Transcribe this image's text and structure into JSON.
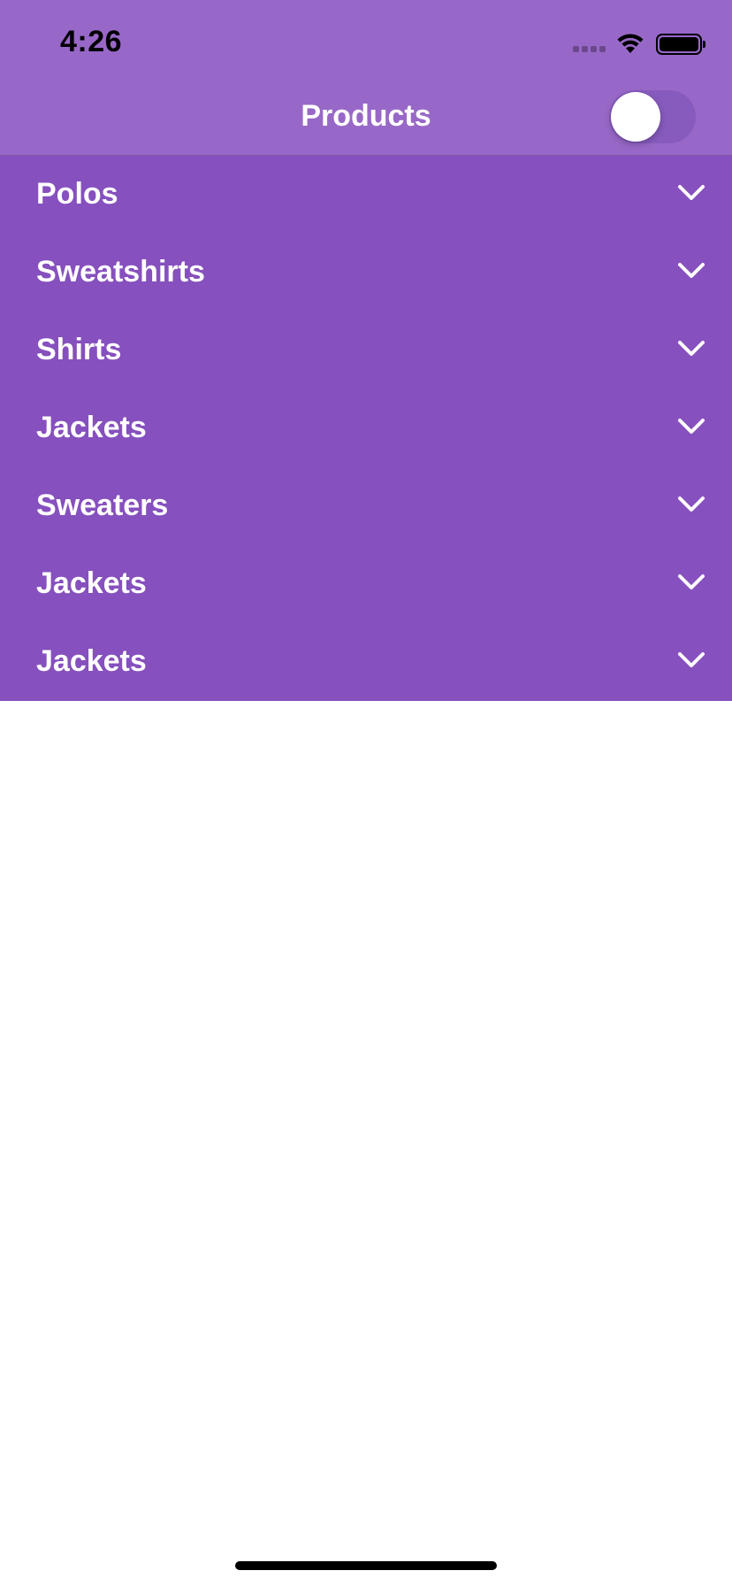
{
  "status_bar": {
    "time": "4:26",
    "icons": [
      "signal-icon",
      "wifi-icon",
      "battery-icon"
    ]
  },
  "nav": {
    "title": "Products",
    "toggle_on": false
  },
  "categories": [
    {
      "label": "Polos",
      "icon": "chevron-down-icon"
    },
    {
      "label": "Sweatshirts",
      "icon": "chevron-down-icon"
    },
    {
      "label": "Shirts",
      "icon": "chevron-down-icon"
    },
    {
      "label": "Jackets",
      "icon": "chevron-down-icon"
    },
    {
      "label": "Sweaters",
      "icon": "chevron-down-icon"
    },
    {
      "label": "Jackets",
      "icon": "chevron-down-icon"
    },
    {
      "label": "Jackets",
      "icon": "chevron-down-icon"
    }
  ],
  "colors": {
    "header_bg": "#9868c8",
    "list_bg": "#8650be",
    "text": "#ffffff",
    "page_bg": "#ffffff"
  }
}
